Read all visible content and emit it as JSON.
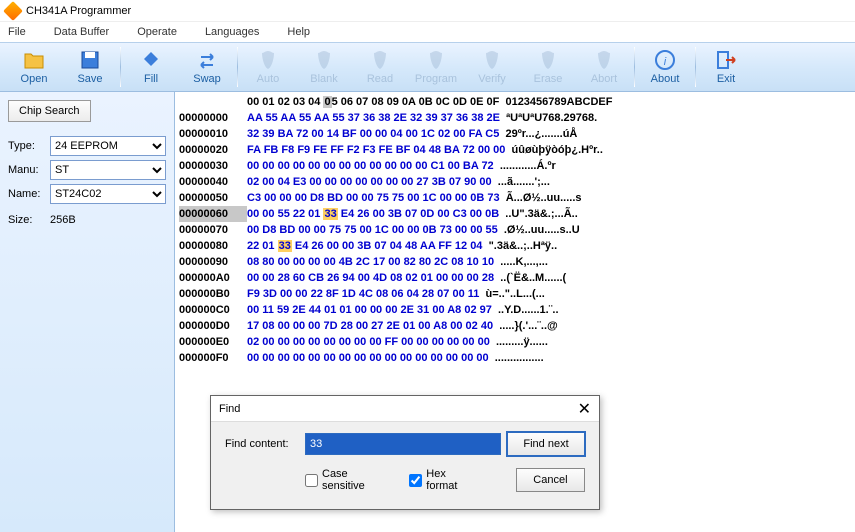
{
  "window": {
    "title": "CH341A Programmer"
  },
  "menu": [
    "File",
    "Data Buffer",
    "Operate",
    "Languages",
    "Help"
  ],
  "toolbar": [
    {
      "name": "open",
      "label": "Open",
      "enabled": true
    },
    {
      "name": "save",
      "label": "Save",
      "enabled": true
    },
    {
      "name": "sep"
    },
    {
      "name": "fill",
      "label": "Fill",
      "enabled": true
    },
    {
      "name": "swap",
      "label": "Swap",
      "enabled": true
    },
    {
      "name": "sep"
    },
    {
      "name": "auto",
      "label": "Auto",
      "enabled": false
    },
    {
      "name": "blank",
      "label": "Blank",
      "enabled": false
    },
    {
      "name": "read",
      "label": "Read",
      "enabled": false
    },
    {
      "name": "program",
      "label": "Program",
      "enabled": false
    },
    {
      "name": "verify",
      "label": "Verify",
      "enabled": false
    },
    {
      "name": "erase",
      "label": "Erase",
      "enabled": false
    },
    {
      "name": "abort",
      "label": "Abort",
      "enabled": false
    },
    {
      "name": "sep"
    },
    {
      "name": "about",
      "label": "About",
      "enabled": true
    },
    {
      "name": "sep"
    },
    {
      "name": "exit",
      "label": "Exit",
      "enabled": true
    }
  ],
  "side": {
    "chip_search": "Chip Search",
    "type_label": "Type:",
    "type_value": "24 EEPROM",
    "manu_label": "Manu:",
    "manu_value": "ST",
    "name_label": "Name:",
    "name_value": "ST24C02",
    "size_label": "Size:",
    "size_value": "256B"
  },
  "hex": {
    "header": "      00 01 02 03 04 05 06 07 08 09 0A 0B 0C 0D 0E 0F  0123456789ABCDEF",
    "rows": [
      {
        "addr": "00000000",
        "b": [
          "AA",
          "55",
          "AA",
          "55",
          "AA",
          "55",
          "37",
          "36",
          "38",
          "2E",
          "32",
          "39",
          "37",
          "36",
          "38",
          "2E"
        ],
        "a": "ªUªUªU768.29768."
      },
      {
        "addr": "00000010",
        "b": [
          "32",
          "39",
          "BA",
          "72",
          "00",
          "14",
          "BF",
          "00",
          "00",
          "04",
          "00",
          "1C",
          "02",
          "00",
          "FA",
          "C5"
        ],
        "a": "29ºr...¿.......úÅ"
      },
      {
        "addr": "00000020",
        "b": [
          "FA",
          "FB",
          "F8",
          "F9",
          "FE",
          "FF",
          "F2",
          "F3",
          "FE",
          "BF",
          "04",
          "48",
          "BA",
          "72",
          "00",
          "00"
        ],
        "a": "úûøùþÿòóþ¿.Hºr.."
      },
      {
        "addr": "00000030",
        "b": [
          "00",
          "00",
          "00",
          "00",
          "00",
          "00",
          "00",
          "00",
          "00",
          "00",
          "00",
          "00",
          "C1",
          "00",
          "BA",
          "72"
        ],
        "a": "............Á.ºr"
      },
      {
        "addr": "00000040",
        "b": [
          "02",
          "00",
          "04",
          "E3",
          "00",
          "00",
          "00",
          "00",
          "00",
          "00",
          "00",
          "27",
          "3B",
          "07",
          "90",
          "00"
        ],
        "a": "...ã.......';..."
      },
      {
        "addr": "00000050",
        "b": [
          "C3",
          "00",
          "00",
          "00",
          "D8",
          "BD",
          "00",
          "00",
          "75",
          "75",
          "00",
          "1C",
          "00",
          "00",
          "0B",
          "73"
        ],
        "a": "Ã...Ø½..uu.....s"
      },
      {
        "addr": "00000060",
        "b": [
          "00",
          "00",
          "55",
          "22",
          "01",
          "33",
          "E4",
          "26",
          "00",
          "3B",
          "07",
          "0D",
          "00",
          "C3",
          "00",
          "0B"
        ],
        "a": "..U\".3ä&.;...Ã.."
      },
      {
        "addr": "00000070",
        "b": [
          "00",
          "D8",
          "BD",
          "00",
          "00",
          "75",
          "75",
          "00",
          "1C",
          "00",
          "00",
          "0B",
          "73",
          "00",
          "00",
          "55"
        ],
        "a": ".Ø½..uu.....s..U"
      },
      {
        "addr": "00000080",
        "b": [
          "22",
          "01",
          "33",
          "E4",
          "26",
          "00",
          "00",
          "3B",
          "07",
          "04",
          "48",
          "AA",
          "FF",
          "12",
          "04"
        ],
        "a": "\".3ä&..;..Hªÿ.."
      },
      {
        "addr": "00000090",
        "b": [
          "08",
          "80",
          "00",
          "00",
          "00",
          "00",
          "4B",
          "2C",
          "17",
          "00",
          "82",
          "80",
          "2C",
          "08",
          "10",
          "10"
        ],
        "a": ".....K,...,..."
      },
      {
        "addr": "000000A0",
        "b": [
          "00",
          "00",
          "28",
          "60",
          "CB",
          "26",
          "94",
          "00",
          "4D",
          "08",
          "02",
          "01",
          "00",
          "00",
          "00",
          "28"
        ],
        "a": "..(`Ë&..M......("
      },
      {
        "addr": "000000B0",
        "b": [
          "F9",
          "3D",
          "00",
          "00",
          "22",
          "8F",
          "1D",
          "4C",
          "08",
          "06",
          "04",
          "28",
          "07",
          "00",
          "11"
        ],
        "a": "ù=..\"..L...(..."
      },
      {
        "addr": "000000C0",
        "b": [
          "00",
          "11",
          "59",
          "2E",
          "44",
          "01",
          "01",
          "00",
          "00",
          "00",
          "2E",
          "31",
          "00",
          "A8",
          "02",
          "97"
        ],
        "a": "..Y.D......1.¨.."
      },
      {
        "addr": "000000D0",
        "b": [
          "17",
          "08",
          "00",
          "00",
          "00",
          "7D",
          "28",
          "00",
          "27",
          "2E",
          "01",
          "00",
          "A8",
          "00",
          "02",
          "40"
        ],
        "a": ".....}(.'...¨..@"
      },
      {
        "addr": "000000E0",
        "b": [
          "02",
          "00",
          "00",
          "00",
          "00",
          "00",
          "00",
          "00",
          "00",
          "FF",
          "00",
          "00",
          "00",
          "00",
          "00",
          "00"
        ],
        "a": ".........ÿ......"
      },
      {
        "addr": "000000F0",
        "b": [
          "00",
          "00",
          "00",
          "00",
          "00",
          "00",
          "00",
          "00",
          "00",
          "00",
          "00",
          "00",
          "00",
          "00",
          "00",
          "00"
        ],
        "a": "................"
      }
    ],
    "selected_row": 6,
    "highlight": "33",
    "cursor_col": 5
  },
  "find": {
    "title": "Find",
    "content_label": "Find content:",
    "content_value": "33",
    "case_label": "Case sensitive",
    "case_checked": false,
    "hex_label": "Hex format",
    "hex_checked": true,
    "findnext": "Find next",
    "cancel": "Cancel"
  }
}
